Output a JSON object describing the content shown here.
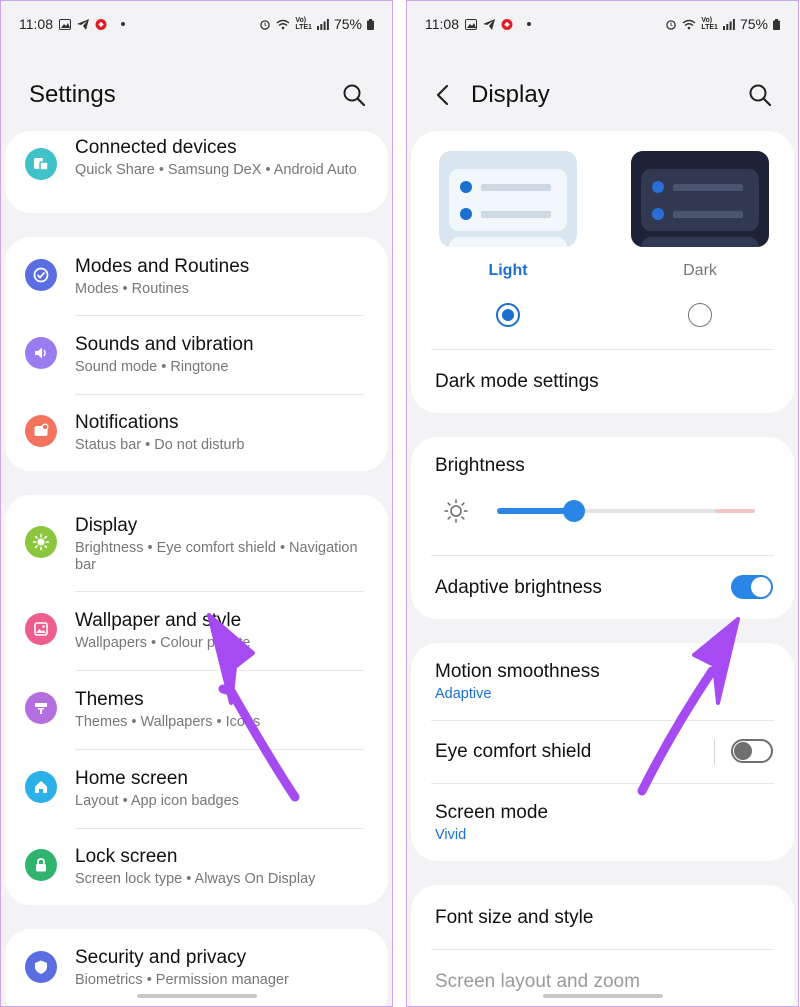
{
  "status_bar": {
    "time": "11:08",
    "battery": "75%",
    "network": "Vo)",
    "lte": "LTE1"
  },
  "left": {
    "title": "Settings",
    "groups": [
      {
        "items": [
          {
            "title": "Connected devices",
            "subtitle": "Quick Share  •  Samsung DeX  •  Android Auto",
            "icon": "connected-devices-icon",
            "color": "#3fc2c8"
          }
        ]
      },
      {
        "items": [
          {
            "title": "Modes and Routines",
            "subtitle": "Modes  •  Routines",
            "icon": "modes-routines-icon",
            "color": "#5b6ee1"
          },
          {
            "title": "Sounds and vibration",
            "subtitle": "Sound mode  •  Ringtone",
            "icon": "volume-icon",
            "color": "#9a7cf0"
          },
          {
            "title": "Notifications",
            "subtitle": "Status bar  •  Do not disturb",
            "icon": "notifications-icon",
            "color": "#f2745f"
          }
        ]
      },
      {
        "items": [
          {
            "title": "Display",
            "subtitle": "Brightness  •  Eye comfort shield  •  Navigation bar",
            "icon": "display-brightness-icon",
            "color": "#8cc63f"
          },
          {
            "title": "Wallpaper and style",
            "subtitle": "Wallpapers  •  Colour palette",
            "icon": "wallpaper-icon",
            "color": "#ee5d8f"
          },
          {
            "title": "Themes",
            "subtitle": "Themes  •  Wallpapers  •  Icons",
            "icon": "themes-icon",
            "color": "#b36ee0"
          },
          {
            "title": "Home screen",
            "subtitle": "Layout  •  App icon badges",
            "icon": "home-icon",
            "color": "#2bb0e8"
          },
          {
            "title": "Lock screen",
            "subtitle": "Screen lock type  •  Always On Display",
            "icon": "lock-icon",
            "color": "#30b36e"
          }
        ]
      },
      {
        "items": [
          {
            "title": "Security and privacy",
            "subtitle": "Biometrics  •  Permission manager",
            "icon": "shield-icon",
            "color": "#5b6ee1"
          }
        ]
      }
    ]
  },
  "right": {
    "title": "Display",
    "theme": {
      "light_label": "Light",
      "dark_label": "Dark",
      "selected": "light"
    },
    "dark_mode_settings": "Dark mode settings",
    "brightness": {
      "label": "Brightness",
      "level": 0.3
    },
    "adaptive_brightness": {
      "label": "Adaptive brightness",
      "on": true
    },
    "motion_smoothness": {
      "label": "Motion smoothness",
      "value": "Adaptive"
    },
    "eye_comfort": {
      "label": "Eye comfort shield",
      "on": false
    },
    "screen_mode": {
      "label": "Screen mode",
      "value": "Vivid"
    },
    "font_size": "Font size and style",
    "screen_layout": "Screen layout and zoom"
  },
  "colors": {
    "accent": "#1a6fcf",
    "arrow": "#a64bf2",
    "toggle_on": "#2a86e6"
  }
}
